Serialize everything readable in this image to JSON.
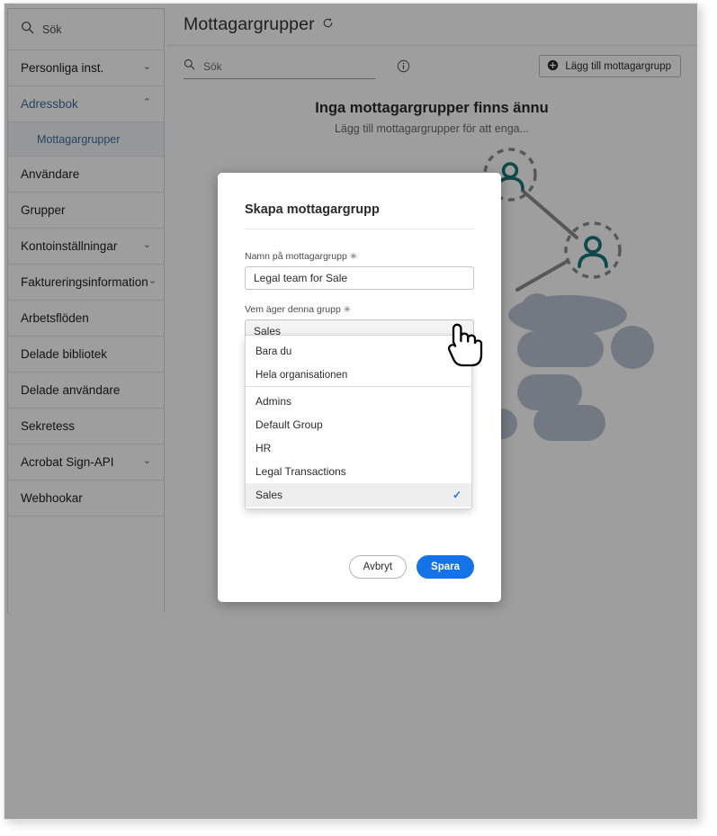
{
  "sidebar": {
    "search_placeholder": "Sök",
    "items": [
      {
        "label": "Personliga inst.",
        "expandable": true,
        "expanded": false,
        "accent": false
      },
      {
        "label": "Adressbok",
        "expandable": true,
        "expanded": true,
        "accent": true
      },
      {
        "label": "Användare",
        "expandable": false,
        "expanded": false,
        "accent": false
      },
      {
        "label": "Grupper",
        "expandable": false,
        "expanded": false,
        "accent": false
      },
      {
        "label": "Kontoinställningar",
        "expandable": true,
        "expanded": false,
        "accent": false
      },
      {
        "label": "Faktureringsinformation",
        "expandable": true,
        "expanded": false,
        "accent": false
      },
      {
        "label": "Arbetsflöden",
        "expandable": false,
        "expanded": false,
        "accent": false
      },
      {
        "label": "Delade bibliotek",
        "expandable": false,
        "expanded": false,
        "accent": false
      },
      {
        "label": "Delade användare",
        "expandable": false,
        "expanded": false,
        "accent": false
      },
      {
        "label": "Sekretess",
        "expandable": false,
        "expanded": false,
        "accent": false
      },
      {
        "label": "Acrobat Sign-API",
        "expandable": true,
        "expanded": false,
        "accent": false
      },
      {
        "label": "Webhookar",
        "expandable": false,
        "expanded": false,
        "accent": false
      }
    ],
    "sub_item": {
      "label": "Mottagargrupper",
      "parent_index": 1,
      "selected": true
    }
  },
  "header": {
    "title": "Mottagargrupper",
    "refresh_icon": "refresh-icon"
  },
  "toolbar": {
    "search_placeholder": "Sök",
    "search_value": "",
    "search_icon": "search-icon",
    "info_icon": "info-icon",
    "add_button_label": "Lägg till mottagargrupp",
    "add_button_icon": "plus-circle-icon"
  },
  "empty_state": {
    "title": "Inga mottagargrupper finns ännu",
    "subtitle": "Lägg till mottagargrupper för att enga..."
  },
  "modal": {
    "title": "Skapa mottagargrupp",
    "name_field": {
      "label": "Namn på mottagargrupp",
      "required_marker": "✳",
      "value": "Legal team for Sale",
      "placeholder": ""
    },
    "owner_field": {
      "label": "Vem äger denna grupp",
      "required_marker": "✳",
      "selected": "Sales",
      "caret_icon": "chevron-down-icon",
      "open": true,
      "options": [
        {
          "label": "Bara du",
          "group": "scope",
          "selected": false
        },
        {
          "label": "Hela organisationen",
          "group": "scope",
          "selected": false
        },
        {
          "label": "Admins",
          "group": "groups",
          "selected": false
        },
        {
          "label": "Default Group",
          "group": "groups",
          "selected": false
        },
        {
          "label": "HR",
          "group": "groups",
          "selected": false
        },
        {
          "label": "Legal Transactions",
          "group": "groups",
          "selected": false
        },
        {
          "label": "Sales",
          "group": "groups",
          "selected": true
        }
      ],
      "check_icon": "check-icon"
    },
    "cancel_label": "Avbryt",
    "save_label": "Spara"
  },
  "colors": {
    "accent_blue": "#1473e6",
    "nav_link_blue": "#3c6ea5",
    "illustration_teal": "#19777a",
    "illustration_blue_gray": "#9fadc4",
    "overlay": "rgba(0,0,0,0.38)"
  },
  "cursor": {
    "type": "pointer-hand-cursor"
  }
}
